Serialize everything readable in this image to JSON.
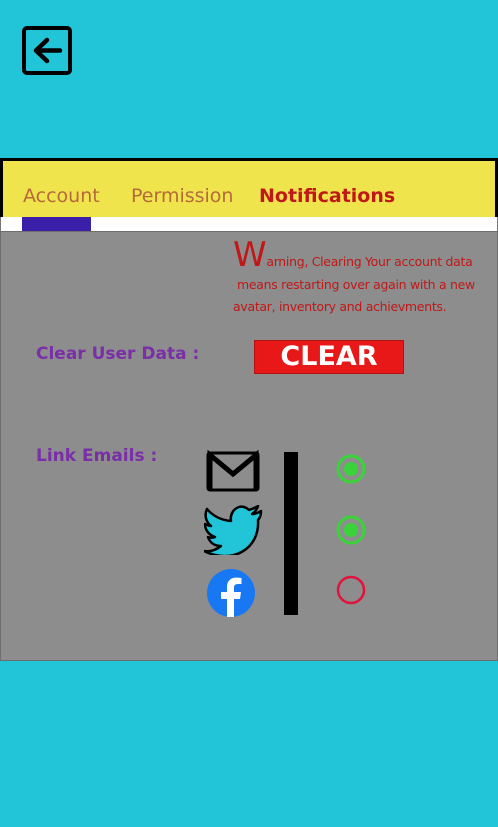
{
  "header": {
    "back_icon": "exit-arrow-icon"
  },
  "tabs": [
    {
      "label": "Account",
      "active": false
    },
    {
      "label": "Permission",
      "active": false
    },
    {
      "label": "Notifications",
      "active": true
    }
  ],
  "warning": {
    "initial": "W",
    "line1_rest": "arning, Clearing Your account data",
    "line2": "means restarting over again with a new",
    "line3": "avatar, inventory and achievments."
  },
  "clear_data": {
    "label": "Clear User Data :",
    "button_label": "CLEAR"
  },
  "link_emails": {
    "label": "Link Emails :",
    "accounts": [
      {
        "icon": "gmail-icon",
        "linked": true
      },
      {
        "icon": "twitter-icon",
        "linked": true
      },
      {
        "icon": "facebook-icon",
        "linked": false
      }
    ]
  },
  "colors": {
    "background": "#22c4d8",
    "tab_bar": "#f0e44c",
    "active_tab_text": "#c01818",
    "inactive_tab_text": "#b46a3c",
    "indicator": "#3a1fa8",
    "panel": "#8d8d8d",
    "label": "#7a2ea8",
    "clear_button": "#e81818",
    "linked": "#3ad43a",
    "unlinked": "#e0143c"
  }
}
